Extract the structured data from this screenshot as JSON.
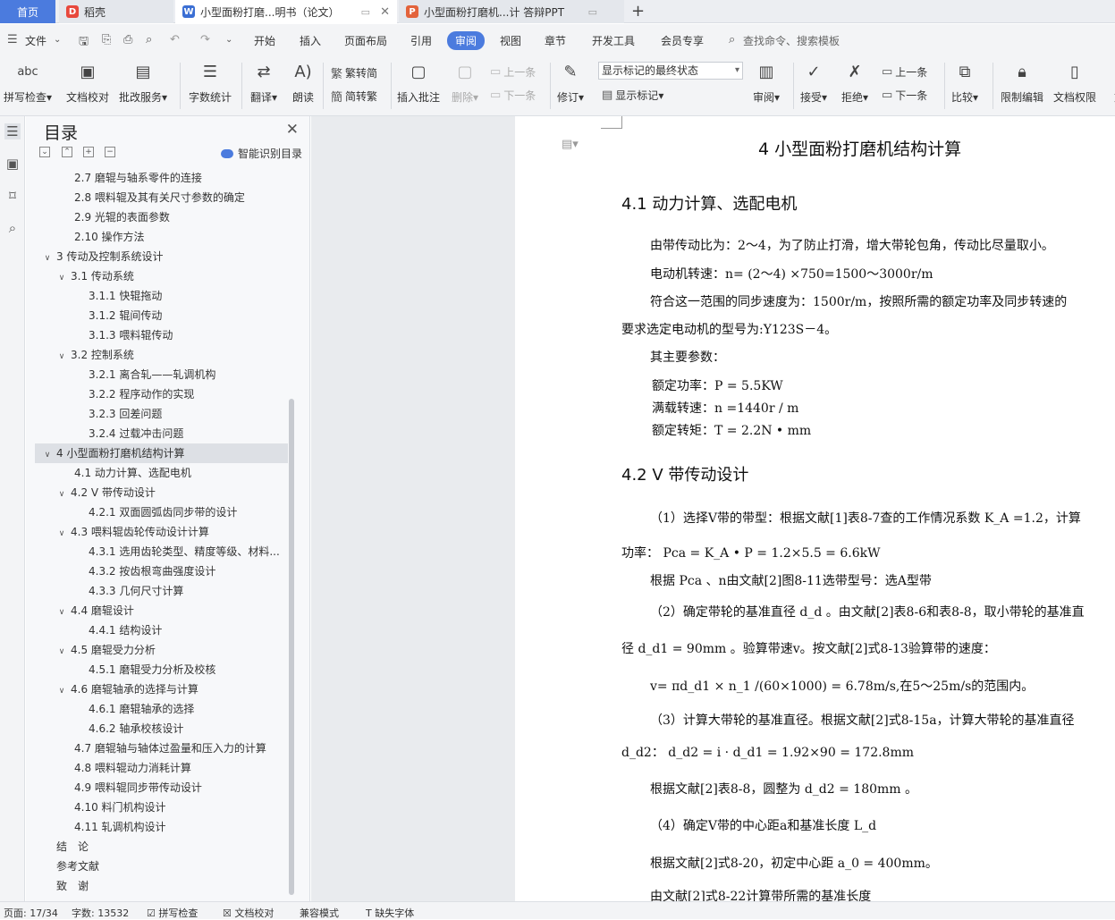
{
  "tabs": {
    "home": "首页",
    "docer": "稻壳",
    "doc": "小型面粉打磨...明书（论文）",
    "ppt": "小型面粉打磨机...计 答辩PPT"
  },
  "menu": {
    "file": "文件",
    "items": [
      "开始",
      "插入",
      "页面布局",
      "引用",
      "审阅",
      "视图",
      "章节",
      "开发工具",
      "会员专享"
    ],
    "search_placeholder": "查找命令、搜索模板"
  },
  "ribbon": {
    "spellcheck": "拼写检查",
    "doc_proof": "文档校对",
    "review_service": "批改服务",
    "word_count": "字数统计",
    "translate": "翻译",
    "read_aloud": "朗读",
    "trad": "繁转简",
    "simp": "简转繁",
    "insert_comment": "插入批注",
    "delete": "删除",
    "prev": "上一条",
    "next": "下一条",
    "track": "修订",
    "markup_select": "显示标记的最终状态",
    "show_markup": "显示标记",
    "review": "审阅",
    "accept": "接受",
    "reject": "拒绝",
    "prev2": "上一条",
    "next2": "下一条",
    "compare": "比较",
    "restrict": "限制编辑",
    "permission": "文档权限",
    "more": "文"
  },
  "toc": {
    "title": "目录",
    "ai_label": "智能识别目录",
    "items": [
      {
        "level": 2,
        "text": "2.7 磨辊与轴系零件的连接",
        "chev": ""
      },
      {
        "level": 2,
        "text": "2.8 喂料辊及其有关尺寸参数的确定",
        "chev": ""
      },
      {
        "level": 2,
        "text": "2.9 光辊的表面参数",
        "chev": ""
      },
      {
        "level": 2,
        "text": "2.10 操作方法",
        "chev": ""
      },
      {
        "level": 1,
        "text": "3 传动及控制系统设计",
        "chev": "v"
      },
      {
        "level": 2,
        "text": "3.1 传动系统",
        "chev": "v"
      },
      {
        "level": 3,
        "text": "3.1.1 快辊拖动",
        "chev": ""
      },
      {
        "level": 3,
        "text": "3.1.2 辊间传动",
        "chev": ""
      },
      {
        "level": 3,
        "text": "3.1.3 喂料辊传动",
        "chev": ""
      },
      {
        "level": 2,
        "text": "3.2 控制系统",
        "chev": "v"
      },
      {
        "level": 3,
        "text": "3.2.1 离合轧——轧调机构",
        "chev": ""
      },
      {
        "level": 3,
        "text": "3.2.2 程序动作的实现",
        "chev": ""
      },
      {
        "level": 3,
        "text": "3.2.3 回差问题",
        "chev": ""
      },
      {
        "level": 3,
        "text": "3.2.4 过载冲击问题",
        "chev": ""
      },
      {
        "level": 1,
        "text": "4 小型面粉打磨机结构计算",
        "chev": "v",
        "selected": true
      },
      {
        "level": 2,
        "text": "4.1 动力计算、选配电机",
        "chev": ""
      },
      {
        "level": 2,
        "text": "4.2 V 带传动设计",
        "chev": "v"
      },
      {
        "level": 3,
        "text": "4.2.1 双面圆弧齿同步带的设计",
        "chev": ""
      },
      {
        "level": 2,
        "text": "4.3 喂料辊齿轮传动设计计算",
        "chev": "v"
      },
      {
        "level": 3,
        "text": "4.3.1 选用齿轮类型、精度等级、材料...",
        "chev": ""
      },
      {
        "level": 3,
        "text": "4.3.2 按齿根弯曲强度设计",
        "chev": ""
      },
      {
        "level": 3,
        "text": "4.3.3 几何尺寸计算",
        "chev": ""
      },
      {
        "level": 2,
        "text": "4.4 磨辊设计",
        "chev": "v"
      },
      {
        "level": 3,
        "text": "4.4.1 结构设计",
        "chev": ""
      },
      {
        "level": 2,
        "text": "4.5 磨辊受力分析",
        "chev": "v"
      },
      {
        "level": 3,
        "text": "4.5.1 磨辊受力分析及校核",
        "chev": ""
      },
      {
        "level": 2,
        "text": "4.6 磨辊轴承的选择与计算",
        "chev": "v"
      },
      {
        "level": 3,
        "text": "4.6.1 磨辊轴承的选择",
        "chev": ""
      },
      {
        "level": 3,
        "text": "4.6.2 轴承校核设计",
        "chev": ""
      },
      {
        "level": 2,
        "text": "4.7 磨辊轴与轴体过盈量和压入力的计算",
        "chev": ""
      },
      {
        "level": 2,
        "text": "4.8 喂料辊动力消耗计算",
        "chev": ""
      },
      {
        "level": 2,
        "text": "4.9 喂料辊同步带传动设计",
        "chev": ""
      },
      {
        "level": 2,
        "text": "4.10 料门机构设计",
        "chev": ""
      },
      {
        "level": 2,
        "text": "4.11 轧调机构设计",
        "chev": ""
      },
      {
        "level": 1,
        "text": "结　论",
        "chev": ""
      },
      {
        "level": 1,
        "text": "参考文献",
        "chev": ""
      },
      {
        "level": 1,
        "text": "致　谢",
        "chev": ""
      }
    ]
  },
  "doc": {
    "title": "4 小型面粉打磨机结构计算",
    "s41": "4.1 动力计算、选配电机",
    "p1": "由带传动比为：2～4，为了防止打滑，增大带轮包角，传动比尽量取小。",
    "p2": "电动机转速：n= (2～4) ×750=1500～3000r/m",
    "p3a": "符合这一范围的同步速度为：1500r/m，按照所需的额定功率及同步转速的",
    "p3b": "要求选定电动机的型号为:Y123S－4。",
    "p4": "其主要参数：",
    "p5": "额定功率：P = 5.5KW",
    "p6": "满载转速：n =1440r / m",
    "p7": "额定转矩：T = 2.2N • mm",
    "s42": "4.2 V 带传动设计",
    "q1": "（1）选择V带的带型：根据文献[1]表8-7查的工作情况系数 K_A =1.2，计算",
    "q2": "功率：  Pca = K_A • P = 1.2×5.5 = 6.6kW",
    "q3": "根据 Pca 、n由文献[2]图8-11选带型号：选A型带",
    "q4": "（2）确定带轮的基准直径 d_d 。由文献[2]表8-6和表8-8，取小带轮的基准直",
    "q5": "径 d_d1 = 90mm 。验算带速v。按文献[2]式8-13验算带的速度：",
    "q6": "v= πd_d1 × n_1 /(60×1000) = 6.78m/s,在5～25m/s的范围内。",
    "q7": "（3）计算大带轮的基准直径。根据文献[2]式8-15a，计算大带轮的基准直径",
    "q8": "d_d2： d_d2 = i · d_d1 = 1.92×90 = 172.8mm",
    "q9": "根据文献[2]表8-8，圆整为 d_d2 = 180mm 。",
    "q10": "（4）确定V带的中心距a和基准长度 L_d",
    "q11": "根据文献[2]式8-20，初定中心距  a_0 =  400mm。",
    "q12": "由文献[2]式8-22计算带所需的基准长度"
  },
  "status": {
    "page": "页面: 17/34",
    "words": "字数: 13532",
    "spell": "拼写检查",
    "proof": "文档校对",
    "compat": "兼容模式",
    "missing_font": "缺失字体"
  },
  "colors": {
    "accent": "#4b7bde",
    "ribbon_bg": "#f3f4f6",
    "doc_bg": "#e9ebee"
  }
}
